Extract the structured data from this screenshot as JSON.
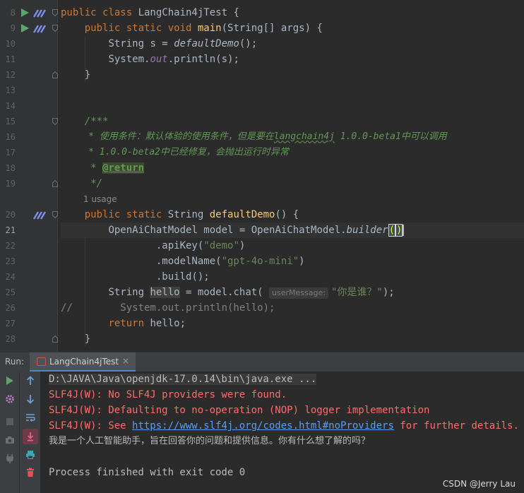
{
  "editor": {
    "line_numbers": [
      "8",
      "9",
      "10",
      "11",
      "12",
      "13",
      "14",
      "15",
      "16",
      "17",
      "18",
      "19",
      "20",
      "21",
      "22",
      "23",
      "24",
      "25",
      "26",
      "27",
      "28"
    ],
    "active_line": "21",
    "usage_hint": "1 usage",
    "lines": {
      "l8": {
        "kw": "public class ",
        "name": "LangChain4jTest {"
      },
      "l9": {
        "indent": "    ",
        "kw": "public static void ",
        "fn": "main",
        "rest": "(String[] args) {"
      },
      "l10": {
        "indent": "        ",
        "pre": "String s = ",
        "call": "defaultDemo",
        "post": "();"
      },
      "l11": {
        "indent": "        ",
        "pre": "System.",
        "field": "out",
        "post": ".println(s);"
      },
      "l12": {
        "indent": "    ",
        "text": "}"
      },
      "l15": {
        "indent": "    ",
        "text": "/***"
      },
      "l16": {
        "indent": "     ",
        "a": "* 使用条件：默认体验的使用条件，但是要在",
        "b": "langchain4j",
        "c": " 1.0.0-beta1中可以调用"
      },
      "l17": {
        "indent": "     ",
        "text": "* 1.0.0-beta2中已经修复，会抛出运行时异常"
      },
      "l18": {
        "indent": "     ",
        "pre": "* ",
        "tag": "@return"
      },
      "l19": {
        "indent": "     ",
        "text": "*/"
      },
      "l20": {
        "indent": "    ",
        "kw": "public static ",
        "type": "String ",
        "fn": "defaultDemo",
        "rest": "() {"
      },
      "l21": {
        "indent": "        ",
        "pre": "OpenAiChatModel model = OpenAiChatModel.",
        "call": "builder",
        "open": "(",
        "close": ")"
      },
      "l22": {
        "indent": "                ",
        "pre": ".apiKey(",
        "str": "\"demo\"",
        "post": ")"
      },
      "l23": {
        "indent": "                ",
        "pre": ".modelName(",
        "str": "\"gpt-4o-mini\"",
        "post": ")"
      },
      "l24": {
        "indent": "                ",
        "text": ".build();"
      },
      "l25": {
        "indent": "        ",
        "pre": "String ",
        "var": "hello",
        "mid": " = model.chat( ",
        "hint": "userMessage:",
        "str": "\"你是谁？\"",
        "post": ");"
      },
      "l26": {
        "text": "//        System.out.println(hello);"
      },
      "l27": {
        "indent": "        ",
        "kw": "return ",
        "rest": "hello;"
      },
      "l28": {
        "indent": "    ",
        "text": "}"
      }
    }
  },
  "run_panel": {
    "label": "Run:",
    "tab_label": "LangChain4jTest",
    "tab_close": "×",
    "console": {
      "command": "D:\\JAVA\\Java\\openjdk-17.0.14\\bin\\java.exe ...",
      "err1": "SLF4J(W): No SLF4J providers were found.",
      "err2": "SLF4J(W): Defaulting to no-operation (NOP) logger implementation",
      "err3_pre": "SLF4J(W): See ",
      "err3_link": "https://www.slf4j.org/codes.html#noProviders",
      "err3_post": " for further details.",
      "answer": "我是一个人工智能助手，旨在回答你的问题和提供信息。你有什么想了解的吗？",
      "exit": "Process finished with exit code 0"
    }
  },
  "watermark": "CSDN @Jerry Lau",
  "colors": {
    "keyword": "#cc7832",
    "function": "#ffc66d",
    "string": "#6a8759",
    "doc_comment": "#629755",
    "error_text": "#ff6b68",
    "link": "#589df6"
  }
}
